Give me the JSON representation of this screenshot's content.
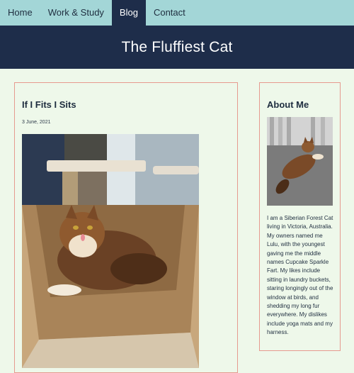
{
  "nav": {
    "items": [
      {
        "label": "Home"
      },
      {
        "label": "Work & Study"
      },
      {
        "label": "Blog"
      },
      {
        "label": "Contact"
      }
    ]
  },
  "header": {
    "title": "The Fluffiest Cat"
  },
  "post": {
    "title": "If I Fits I Sits",
    "date": "3 June, 2021"
  },
  "about": {
    "title": "About Me",
    "text": "I am a Siberian Forest Cat living in Victoria, Australia. My owners named me Lulu, with the youngest gaving me the middle names Cupcake Sparkle Fart. My likes include sitting in laundry buckets, staring longingly out of the window at birds, and shedding my long fur everywhere. My dislikes include yoga mats and my harness."
  },
  "colors": {
    "nav_bg": "#a3d6d7",
    "header_bg": "#1e2d4a",
    "page_bg": "#eef8ea",
    "card_border": "#e69a8f"
  }
}
